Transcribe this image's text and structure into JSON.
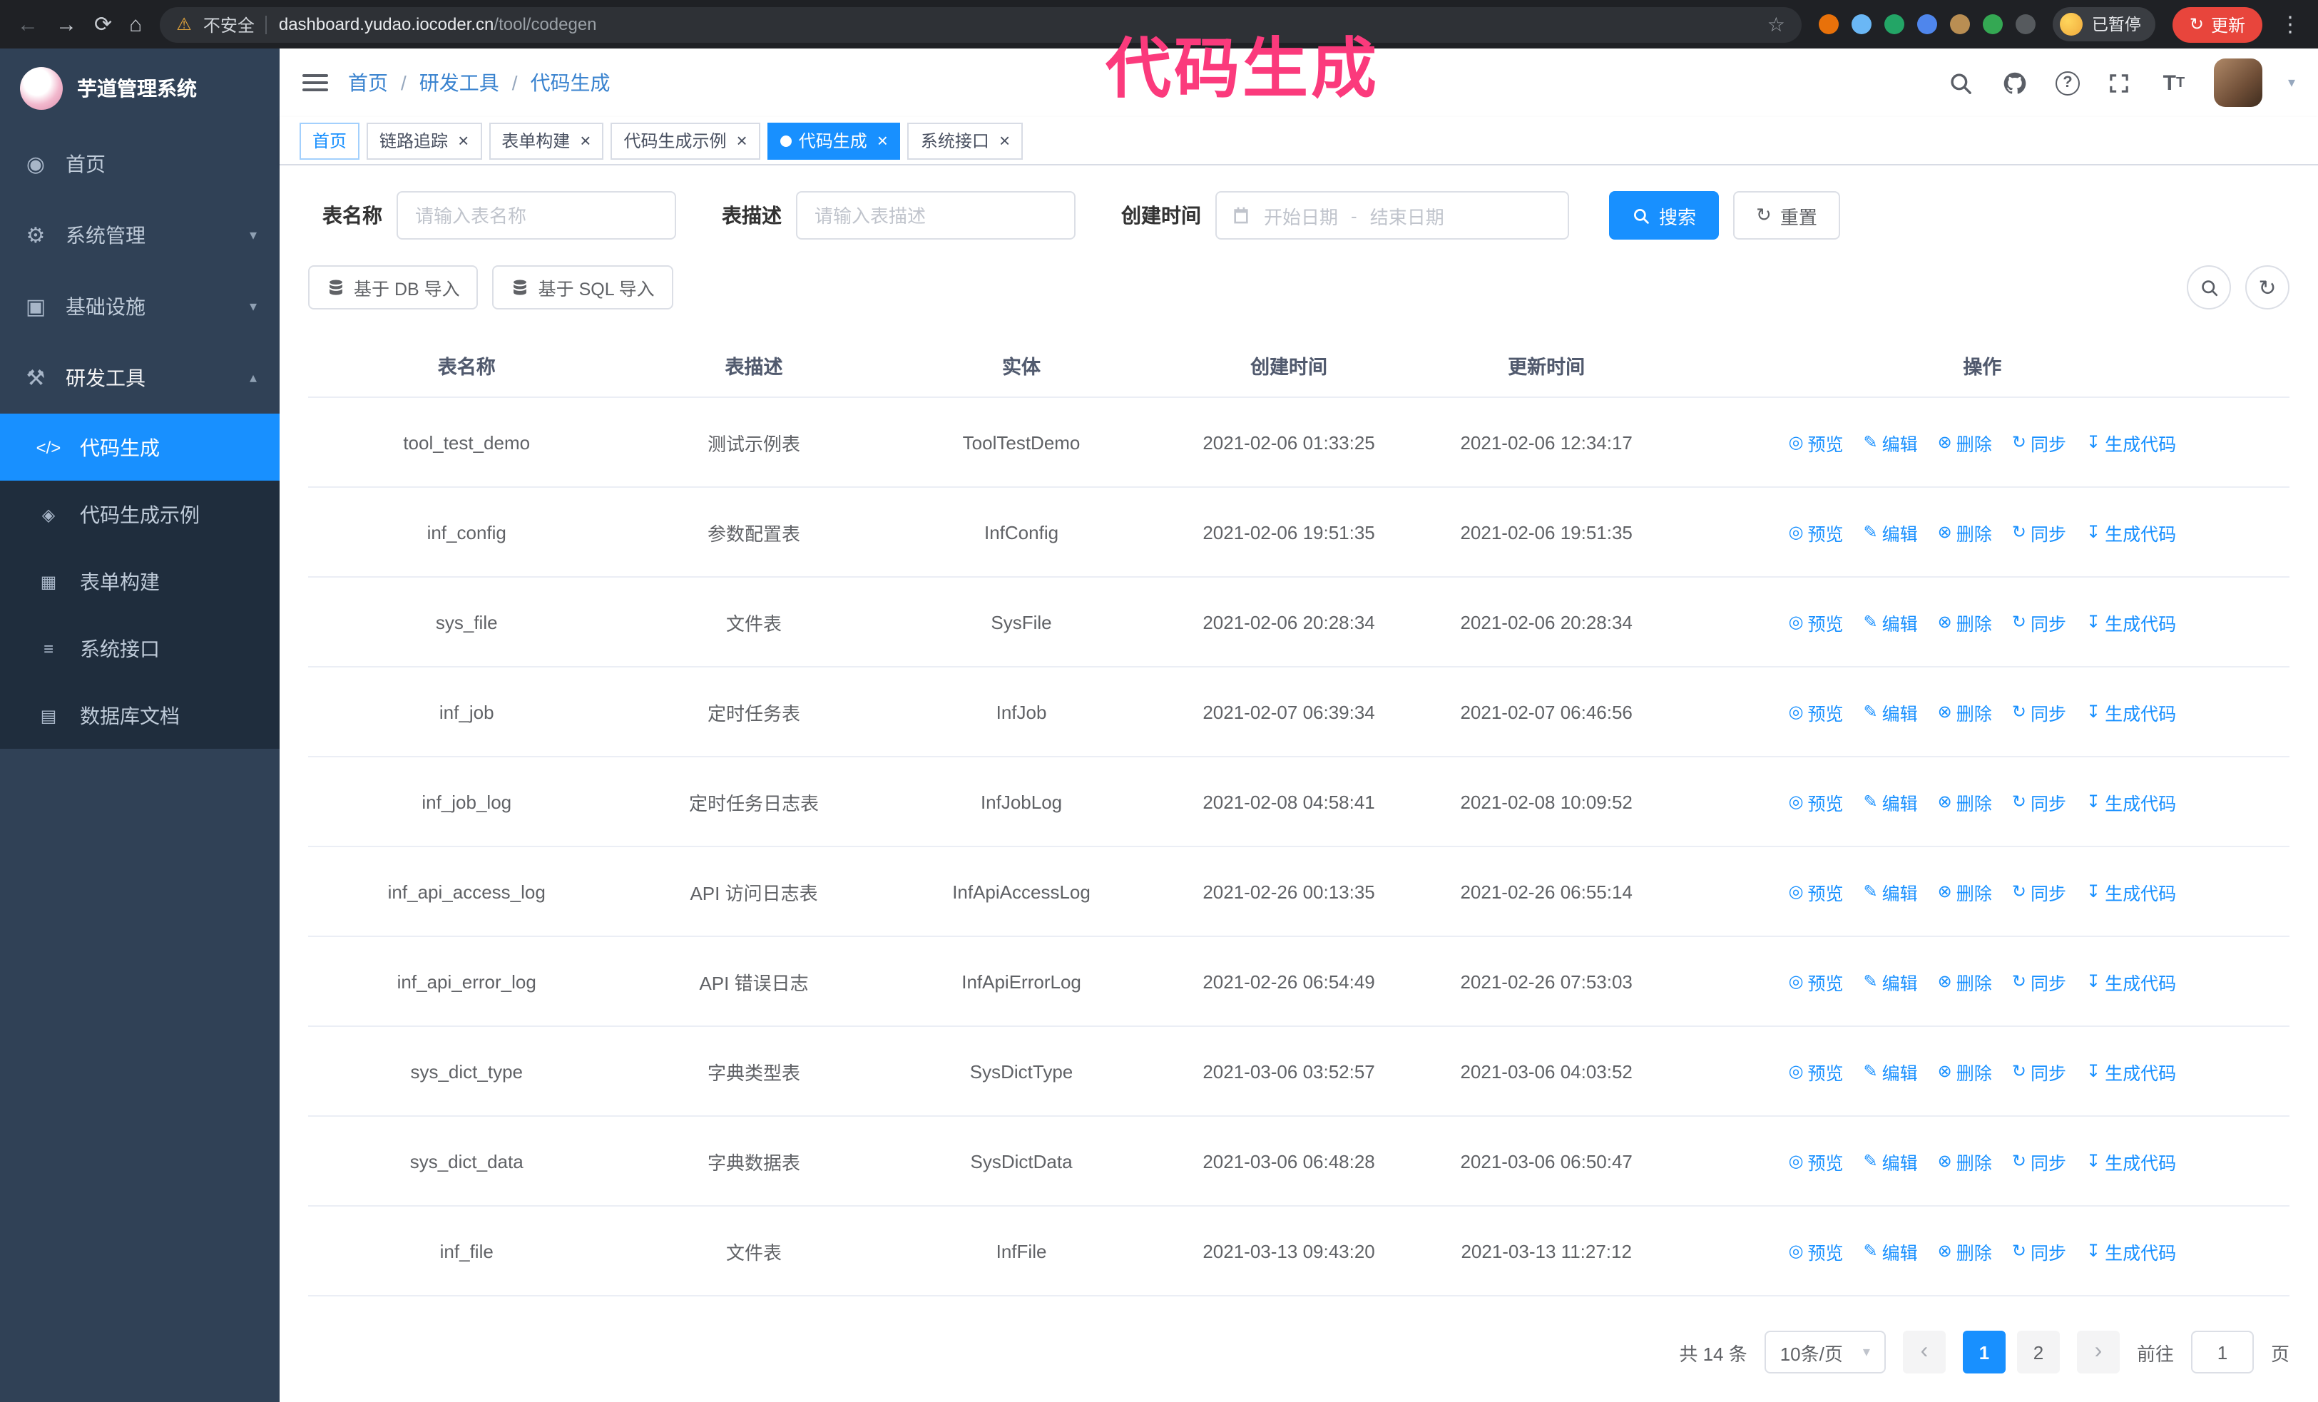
{
  "annotation": {
    "text": "代码生成",
    "color": "#fb3a7c"
  },
  "colors": {
    "primary": "#1890ff",
    "sidebar_bg": "#304156",
    "submenu_bg": "#1f2d3d",
    "active_menu": "#1890ff",
    "update_button_red": "#e8453c",
    "annotation_pink": "#fb3a7c"
  },
  "browser": {
    "security_chip": "不安全",
    "url_host": "dashboard.yudao.iocoder.cn",
    "url_path": "/tool/codegen",
    "extension_colors": [
      "#e8710a",
      "#6ab7f5",
      "#23a566",
      "#4f86ec",
      "#b98e53",
      "#34a853",
      "#565a5e"
    ],
    "profile_chip": "已暂停",
    "update_button": "更新"
  },
  "sidebar": {
    "logo_title": "芋道管理系统",
    "items": [
      {
        "label": "首页",
        "icon": "dashboard-icon",
        "expandable": false,
        "expanded": false
      },
      {
        "label": "系统管理",
        "icon": "system-icon",
        "expandable": true,
        "expanded": false
      },
      {
        "label": "基础设施",
        "icon": "infra-icon",
        "expandable": true,
        "expanded": false
      },
      {
        "label": "研发工具",
        "icon": "tools-icon",
        "expandable": true,
        "expanded": true
      }
    ],
    "submenu": [
      {
        "label": "代码生成",
        "icon": "code-icon",
        "active": true
      },
      {
        "label": "代码生成示例",
        "icon": "example-icon",
        "active": false
      },
      {
        "label": "表单构建",
        "icon": "form-icon",
        "active": false
      },
      {
        "label": "系统接口",
        "icon": "api-icon",
        "active": false
      },
      {
        "label": "数据库文档",
        "icon": "dbdoc-icon",
        "active": false
      }
    ]
  },
  "header": {
    "breadcrumb": [
      "首页",
      "研发工具",
      "代码生成"
    ]
  },
  "tabs": [
    {
      "label": "首页",
      "closable": false,
      "active": false,
      "affix": true
    },
    {
      "label": "链路追踪",
      "closable": true,
      "active": false,
      "affix": false
    },
    {
      "label": "表单构建",
      "closable": true,
      "active": false,
      "affix": false
    },
    {
      "label": "代码生成示例",
      "closable": true,
      "active": false,
      "affix": false
    },
    {
      "label": "代码生成",
      "closable": true,
      "active": true,
      "affix": false
    },
    {
      "label": "系统接口",
      "closable": true,
      "active": false,
      "affix": false
    }
  ],
  "filters": {
    "table_name_label": "表名称",
    "table_name_placeholder": "请输入表名称",
    "table_desc_label": "表描述",
    "table_desc_placeholder": "请输入表描述",
    "create_time_label": "创建时间",
    "date_start_placeholder": "开始日期",
    "date_separator": "-",
    "date_end_placeholder": "结束日期",
    "search_button": "搜索",
    "reset_button": "重置"
  },
  "toolbar": {
    "import_db": "基于 DB 导入",
    "import_sql": "基于 SQL 导入"
  },
  "table": {
    "columns": [
      "表名称",
      "表描述",
      "实体",
      "创建时间",
      "更新时间",
      "操作"
    ],
    "actions": [
      {
        "label": "预览",
        "icon": "eye-icon",
        "name": "preview-link"
      },
      {
        "label": "编辑",
        "icon": "edit-icon",
        "name": "edit-link"
      },
      {
        "label": "删除",
        "icon": "delete-icon",
        "name": "delete-link"
      },
      {
        "label": "同步",
        "icon": "sync-icon",
        "name": "sync-link"
      },
      {
        "label": "生成代码",
        "icon": "gencode-icon",
        "name": "generate-code-link"
      }
    ],
    "rows": [
      {
        "name": "tool_test_demo",
        "desc": "测试示例表",
        "entity": "ToolTestDemo",
        "created": "2021-02-06 01:33:25",
        "updated": "2021-02-06 12:34:17"
      },
      {
        "name": "inf_config",
        "desc": "参数配置表",
        "entity": "InfConfig",
        "created": "2021-02-06 19:51:35",
        "updated": "2021-02-06 19:51:35"
      },
      {
        "name": "sys_file",
        "desc": "文件表",
        "entity": "SysFile",
        "created": "2021-02-06 20:28:34",
        "updated": "2021-02-06 20:28:34"
      },
      {
        "name": "inf_job",
        "desc": "定时任务表",
        "entity": "InfJob",
        "created": "2021-02-07 06:39:34",
        "updated": "2021-02-07 06:46:56"
      },
      {
        "name": "inf_job_log",
        "desc": "定时任务日志表",
        "entity": "InfJobLog",
        "created": "2021-02-08 04:58:41",
        "updated": "2021-02-08 10:09:52"
      },
      {
        "name": "inf_api_access_log",
        "desc": "API 访问日志表",
        "entity": "InfApiAccessLog",
        "created": "2021-02-26 00:13:35",
        "updated": "2021-02-26 06:55:14"
      },
      {
        "name": "inf_api_error_log",
        "desc": "API 错误日志",
        "entity": "InfApiErrorLog",
        "created": "2021-02-26 06:54:49",
        "updated": "2021-02-26 07:53:03"
      },
      {
        "name": "sys_dict_type",
        "desc": "字典类型表",
        "entity": "SysDictType",
        "created": "2021-03-06 03:52:57",
        "updated": "2021-03-06 04:03:52"
      },
      {
        "name": "sys_dict_data",
        "desc": "字典数据表",
        "entity": "SysDictData",
        "created": "2021-03-06 06:48:28",
        "updated": "2021-03-06 06:50:47"
      },
      {
        "name": "inf_file",
        "desc": "文件表",
        "entity": "InfFile",
        "created": "2021-03-13 09:43:20",
        "updated": "2021-03-13 11:27:12"
      }
    ]
  },
  "pagination": {
    "total_text": "共 14 条",
    "page_size_text": "10条/页",
    "pages": [
      "1",
      "2"
    ],
    "active_page": "1",
    "goto_label": "前往",
    "goto_value": "1",
    "goto_suffix": "页"
  }
}
